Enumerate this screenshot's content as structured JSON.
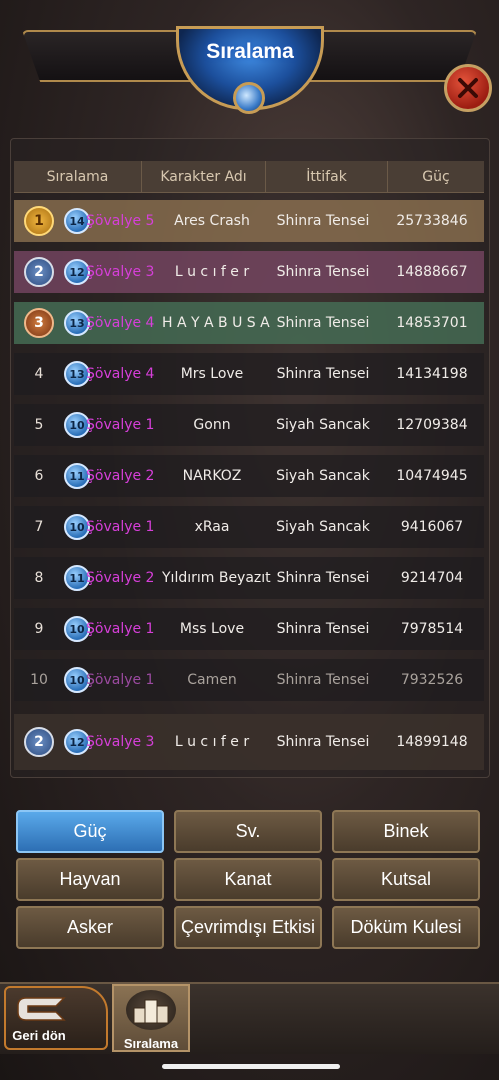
{
  "header": {
    "title": "Sıralama"
  },
  "columns": [
    "Sıralama",
    "Karakter Adı",
    "İttifak",
    "Güç"
  ],
  "rows": [
    {
      "rank": "1",
      "level": "14",
      "title": "Şövalye 5",
      "name": "Ares Crash",
      "alliance": "Shinra Tensei",
      "power": "25733846"
    },
    {
      "rank": "2",
      "level": "12",
      "title": "Şövalye 3",
      "name": "L u c ı f e r",
      "alliance": "Shinra Tensei",
      "power": "14888667"
    },
    {
      "rank": "3",
      "level": "13",
      "title": "Şövalye 4",
      "name": "H A Y A B U S A",
      "alliance": "Shinra Tensei",
      "power": "14853701"
    },
    {
      "rank": "4",
      "level": "13",
      "title": "Şövalye 4",
      "name": "Mrs Love",
      "alliance": "Shinra Tensei",
      "power": "14134198"
    },
    {
      "rank": "5",
      "level": "10",
      "title": "Şövalye 1",
      "name": "Gonn",
      "alliance": "Siyah Sancak",
      "power": "12709384"
    },
    {
      "rank": "6",
      "level": "11",
      "title": "Şövalye 2",
      "name": "NARKOZ",
      "alliance": "Siyah Sancak",
      "power": "10474945"
    },
    {
      "rank": "7",
      "level": "10",
      "title": "Şövalye 1",
      "name": "xRaa",
      "alliance": "Siyah Sancak",
      "power": "9416067"
    },
    {
      "rank": "8",
      "level": "11",
      "title": "Şövalye 2",
      "name": "Yıldırım Beyazıt",
      "alliance": "Shinra Tensei",
      "power": "9214704"
    },
    {
      "rank": "9",
      "level": "10",
      "title": "Şövalye 1",
      "name": "Mss Love",
      "alliance": "Shinra Tensei",
      "power": "7978514"
    },
    {
      "rank": "10",
      "level": "10",
      "title": "Şövalye 1",
      "name": "Camen",
      "alliance": "Shinra Tensei",
      "power": "7932526"
    }
  ],
  "self_row": {
    "rank": "2",
    "level": "12",
    "title": "Şövalye 3",
    "name": "L u c ı f e r",
    "alliance": "Shinra Tensei",
    "power": "14899148"
  },
  "categories": [
    "Güç",
    "Sv.",
    "Binek",
    "Hayvan",
    "Kanat",
    "Kutsal",
    "Asker",
    "Çevrimdışı Etkisi",
    "Döküm Kulesi"
  ],
  "active_category": "Güç",
  "bottom_nav": {
    "back_label": "Geri dön",
    "ranking_label": "Sıralama"
  },
  "colors": {
    "accent_blue": "#3a8ee0",
    "title_purple": "#d63fd9",
    "gold": "#c79c55"
  }
}
